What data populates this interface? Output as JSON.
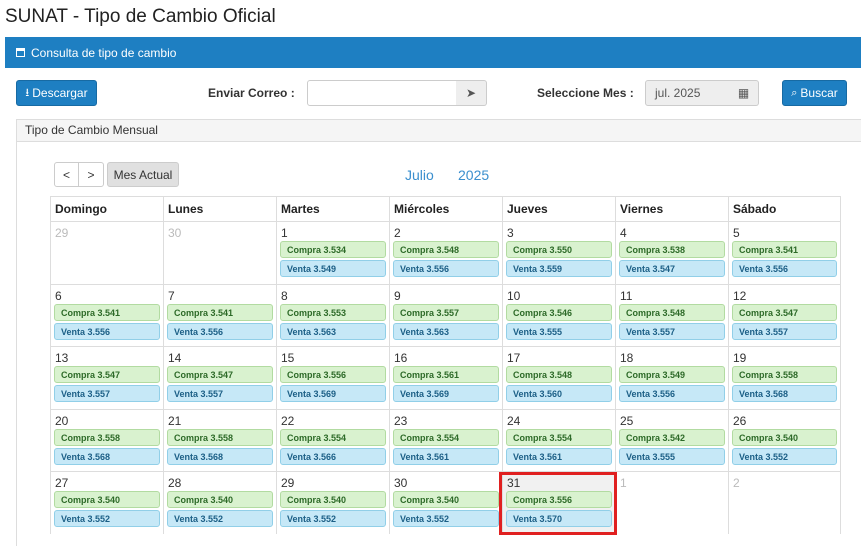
{
  "page_title": "SUNAT - Tipo de Cambio Oficial",
  "panel_title": "Consulta de tipo de cambio",
  "toolbar": {
    "download_label": "Descargar",
    "email_label": "Enviar Correo :",
    "email_value": "",
    "month_label": "Seleccione Mes :",
    "month_value": "jul. 2025",
    "search_label": "Buscar"
  },
  "calendar": {
    "panel_title": "Tipo de Cambio Mensual",
    "prev_label": "<",
    "next_label": ">",
    "current_month_label": "Mes Actual",
    "month": "Julio",
    "year": "2025",
    "weekdays": [
      "Domingo",
      "Lunes",
      "Martes",
      "Miércoles",
      "Jueves",
      "Viernes",
      "Sábado"
    ],
    "weeks": [
      [
        {
          "day": "29",
          "other": true
        },
        {
          "day": "30",
          "other": true
        },
        {
          "day": "1",
          "compra": "Compra 3.534",
          "venta": "Venta 3.549"
        },
        {
          "day": "2",
          "compra": "Compra 3.548",
          "venta": "Venta 3.556"
        },
        {
          "day": "3",
          "compra": "Compra 3.550",
          "venta": "Venta 3.559"
        },
        {
          "day": "4",
          "compra": "Compra 3.538",
          "venta": "Venta 3.547"
        },
        {
          "day": "5",
          "compra": "Compra 3.541",
          "venta": "Venta 3.556"
        }
      ],
      [
        {
          "day": "6",
          "compra": "Compra 3.541",
          "venta": "Venta 3.556"
        },
        {
          "day": "7",
          "compra": "Compra 3.541",
          "venta": "Venta 3.556"
        },
        {
          "day": "8",
          "compra": "Compra 3.553",
          "venta": "Venta 3.563"
        },
        {
          "day": "9",
          "compra": "Compra 3.557",
          "venta": "Venta 3.563"
        },
        {
          "day": "10",
          "compra": "Compra 3.546",
          "venta": "Venta 3.555"
        },
        {
          "day": "11",
          "compra": "Compra 3.548",
          "venta": "Venta 3.557"
        },
        {
          "day": "12",
          "compra": "Compra 3.547",
          "venta": "Venta 3.557"
        }
      ],
      [
        {
          "day": "13",
          "compra": "Compra 3.547",
          "venta": "Venta 3.557"
        },
        {
          "day": "14",
          "compra": "Compra 3.547",
          "venta": "Venta 3.557"
        },
        {
          "day": "15",
          "compra": "Compra 3.556",
          "venta": "Venta 3.569"
        },
        {
          "day": "16",
          "compra": "Compra 3.561",
          "venta": "Venta 3.569"
        },
        {
          "day": "17",
          "compra": "Compra 3.548",
          "venta": "Venta 3.560"
        },
        {
          "day": "18",
          "compra": "Compra 3.549",
          "venta": "Venta 3.556"
        },
        {
          "day": "19",
          "compra": "Compra 3.558",
          "venta": "Venta 3.568"
        }
      ],
      [
        {
          "day": "20",
          "compra": "Compra 3.558",
          "venta": "Venta 3.568"
        },
        {
          "day": "21",
          "compra": "Compra 3.558",
          "venta": "Venta 3.568"
        },
        {
          "day": "22",
          "compra": "Compra 3.554",
          "venta": "Venta 3.566"
        },
        {
          "day": "23",
          "compra": "Compra 3.554",
          "venta": "Venta 3.561"
        },
        {
          "day": "24",
          "compra": "Compra 3.554",
          "venta": "Venta 3.561"
        },
        {
          "day": "25",
          "compra": "Compra 3.542",
          "venta": "Venta 3.555"
        },
        {
          "day": "26",
          "compra": "Compra 3.540",
          "venta": "Venta 3.552"
        }
      ],
      [
        {
          "day": "27",
          "compra": "Compra 3.540",
          "venta": "Venta 3.552"
        },
        {
          "day": "28",
          "compra": "Compra 3.540",
          "venta": "Venta 3.552"
        },
        {
          "day": "29",
          "compra": "Compra 3.540",
          "venta": "Venta 3.552"
        },
        {
          "day": "30",
          "compra": "Compra 3.540",
          "venta": "Venta 3.552"
        },
        {
          "day": "31",
          "compra": "Compra 3.556",
          "venta": "Venta 3.570",
          "today": true
        },
        {
          "day": "1",
          "other": true
        },
        {
          "day": "2",
          "other": true
        }
      ]
    ]
  },
  "colors": {
    "primary": "#1e7fc2",
    "compra_bg": "#d9f2cf",
    "venta_bg": "#c6e8f7",
    "highlight": "#e02020"
  }
}
